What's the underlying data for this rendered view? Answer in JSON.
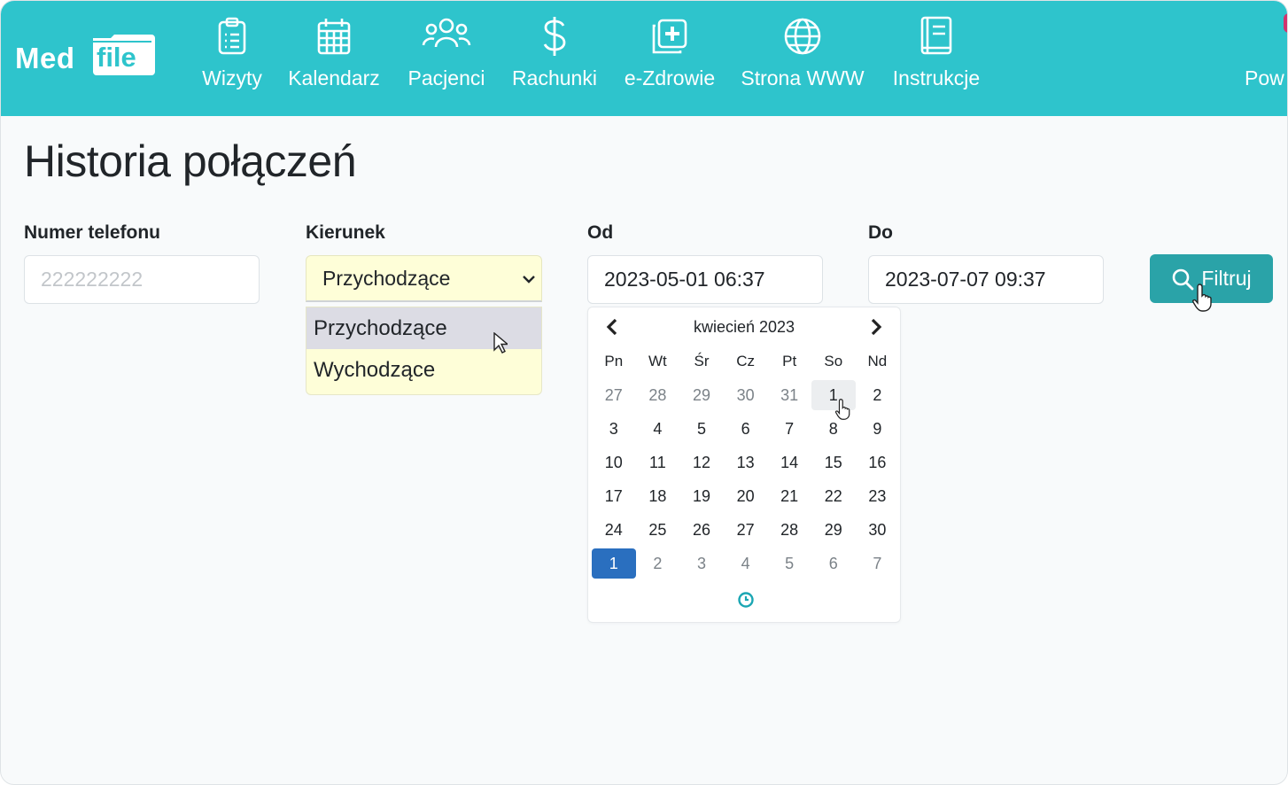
{
  "app": {
    "brand_med": "Med",
    "brand_file": "file"
  },
  "nav": {
    "items": [
      {
        "label": "Wizyty",
        "icon": "clipboard-list-icon"
      },
      {
        "label": "Kalendarz",
        "icon": "calendar-icon"
      },
      {
        "label": "Pacjenci",
        "icon": "users-icon"
      },
      {
        "label": "Rachunki",
        "icon": "dollar-icon"
      },
      {
        "label": "e-Zdrowie",
        "icon": "medical-plus-icon"
      },
      {
        "label": "Strona WWW",
        "icon": "globe-icon"
      },
      {
        "label": "Instrukcje",
        "icon": "book-icon"
      }
    ],
    "overflow_label": "Pow"
  },
  "page": {
    "title": "Historia połączeń"
  },
  "filters": {
    "phone": {
      "label": "Numer telefonu",
      "placeholder": "222222222"
    },
    "direction": {
      "label": "Kierunek",
      "selected": "Przychodzące",
      "options": [
        "Przychodzące",
        "Wychodzące"
      ]
    },
    "from": {
      "label": "Od",
      "value": "2023-05-01 06:37"
    },
    "to": {
      "label": "Do",
      "value": "2023-07-07 09:37"
    },
    "submit_label": "Filtruj"
  },
  "calendar": {
    "month_title": "kwiecień 2023",
    "weekdays": [
      "Pn",
      "Wt",
      "Śr",
      "Cz",
      "Pt",
      "So",
      "Nd"
    ],
    "weeks": [
      [
        "27",
        "28",
        "29",
        "30",
        "31",
        "1",
        "2"
      ],
      [
        "3",
        "4",
        "5",
        "6",
        "7",
        "8",
        "9"
      ],
      [
        "10",
        "11",
        "12",
        "13",
        "14",
        "15",
        "16"
      ],
      [
        "17",
        "18",
        "19",
        "20",
        "21",
        "22",
        "23"
      ],
      [
        "24",
        "25",
        "26",
        "27",
        "28",
        "29",
        "30"
      ],
      [
        "1",
        "2",
        "3",
        "4",
        "5",
        "6",
        "7"
      ]
    ],
    "hovered_day": "1",
    "selected_day": "1"
  },
  "colors": {
    "navbar": "#2ec4cc",
    "button": "#2aa3a8",
    "selected_day": "#2a6fbf",
    "select_bg": "#fefed8"
  }
}
